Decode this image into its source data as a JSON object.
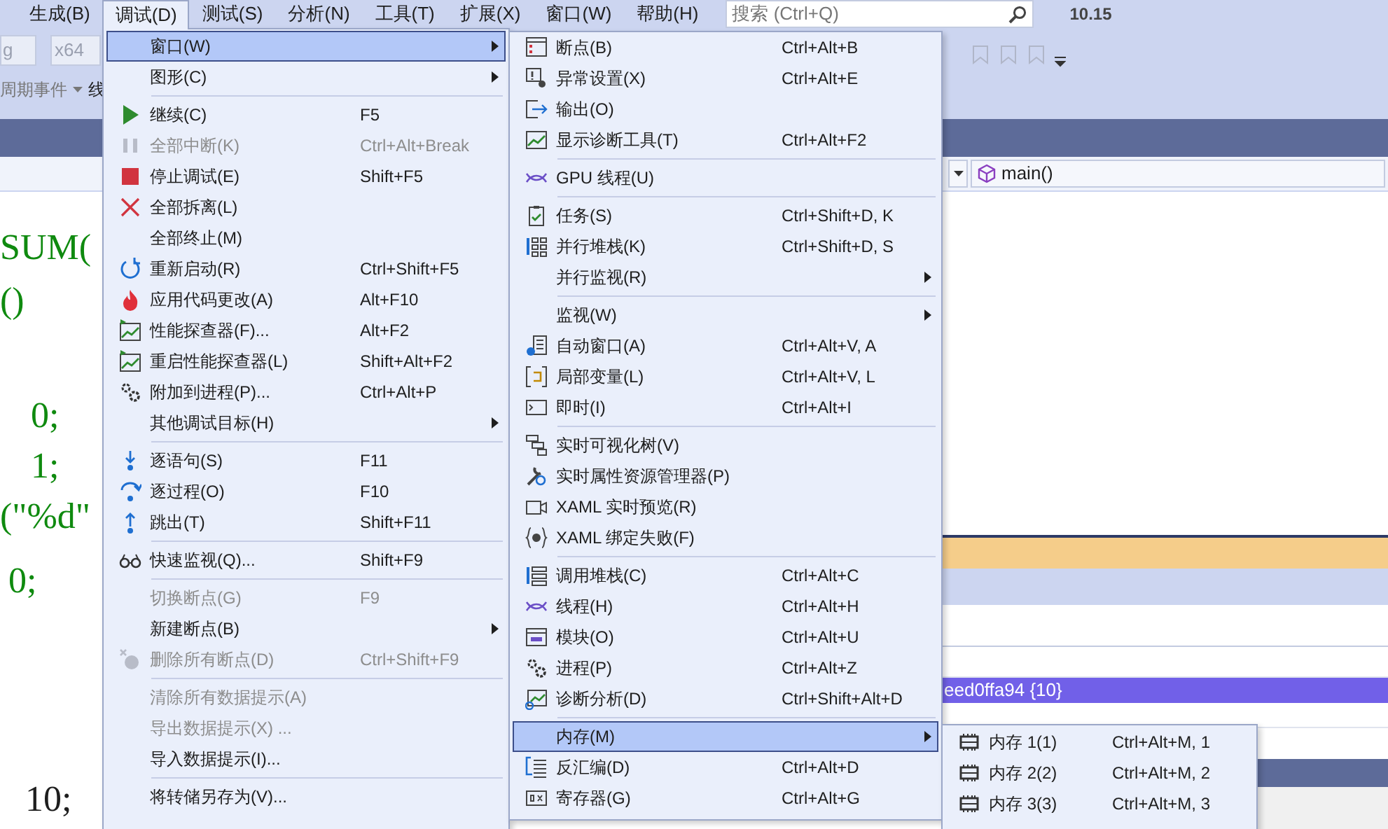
{
  "menubar": {
    "items": [
      {
        "label": "生成(B)",
        "selected": false
      },
      {
        "label": "调试(D)",
        "selected": true
      },
      {
        "label": "测试(S)",
        "selected": false
      },
      {
        "label": "分析(N)",
        "selected": false
      },
      {
        "label": "工具(T)",
        "selected": false
      },
      {
        "label": "扩展(X)",
        "selected": false
      },
      {
        "label": "窗口(W)",
        "selected": false
      },
      {
        "label": "帮助(H)",
        "selected": false
      }
    ],
    "search": {
      "placeholder": "搜索 (Ctrl+Q)"
    },
    "version": "10.15"
  },
  "toolbar": {
    "configuration": "g",
    "platform": "x64",
    "events_label": "周期事件",
    "thread_label": "线"
  },
  "navigation": {
    "function": "main()"
  },
  "editor": {
    "lines": [
      {
        "text": "SUM(",
        "kind": "code"
      },
      {
        "text": "()",
        "kind": "code"
      },
      {
        "text": "0;",
        "kind": "code"
      },
      {
        "text": "1;",
        "kind": "code"
      },
      {
        "text": "(\"%d\"",
        "kind": "code"
      },
      {
        "text": "0;",
        "kind": "code"
      },
      {
        "text": "10;",
        "kind": "literal"
      }
    ]
  },
  "watch_panel": {
    "selected_value": "eed0ffa94 {10}"
  },
  "debug_menu": {
    "items": [
      {
        "kind": "item",
        "label": "窗口(W)",
        "submenu": true,
        "selected": true,
        "disabled": false
      },
      {
        "kind": "item",
        "label": "图形(C)",
        "submenu": true,
        "selected": false,
        "disabled": false
      },
      {
        "kind": "separator"
      },
      {
        "kind": "item",
        "label": "继续(C)",
        "shortcut": "F5",
        "selected": false,
        "disabled": false
      },
      {
        "kind": "item",
        "label": "全部中断(K)",
        "shortcut": "Ctrl+Alt+Break",
        "selected": false,
        "disabled": true
      },
      {
        "kind": "item",
        "label": "停止调试(E)",
        "shortcut": "Shift+F5",
        "selected": false,
        "disabled": false
      },
      {
        "kind": "item",
        "label": "全部拆离(L)",
        "selected": false,
        "disabled": false
      },
      {
        "kind": "item",
        "label": "全部终止(M)",
        "selected": false,
        "disabled": false
      },
      {
        "kind": "item",
        "label": "重新启动(R)",
        "shortcut": "Ctrl+Shift+F5",
        "selected": false,
        "disabled": false
      },
      {
        "kind": "item",
        "label": "应用代码更改(A)",
        "shortcut": "Alt+F10",
        "selected": false,
        "disabled": false
      },
      {
        "kind": "item",
        "label": "性能探查器(F)...",
        "shortcut": "Alt+F2",
        "selected": false,
        "disabled": false
      },
      {
        "kind": "item",
        "label": "重启性能探查器(L)",
        "shortcut": "Shift+Alt+F2",
        "selected": false,
        "disabled": false
      },
      {
        "kind": "item",
        "label": "附加到进程(P)...",
        "shortcut": "Ctrl+Alt+P",
        "selected": false,
        "disabled": false
      },
      {
        "kind": "item",
        "label": "其他调试目标(H)",
        "submenu": true,
        "selected": false,
        "disabled": false
      },
      {
        "kind": "separator"
      },
      {
        "kind": "item",
        "label": "逐语句(S)",
        "shortcut": "F11",
        "selected": false,
        "disabled": false
      },
      {
        "kind": "item",
        "label": "逐过程(O)",
        "shortcut": "F10",
        "selected": false,
        "disabled": false
      },
      {
        "kind": "item",
        "label": "跳出(T)",
        "shortcut": "Shift+F11",
        "selected": false,
        "disabled": false
      },
      {
        "kind": "separator"
      },
      {
        "kind": "item",
        "label": "快速监视(Q)...",
        "shortcut": "Shift+F9",
        "selected": false,
        "disabled": false
      },
      {
        "kind": "separator"
      },
      {
        "kind": "item",
        "label": "切换断点(G)",
        "shortcut": "F9",
        "selected": false,
        "disabled": true
      },
      {
        "kind": "item",
        "label": "新建断点(B)",
        "submenu": true,
        "selected": false,
        "disabled": false
      },
      {
        "kind": "item",
        "label": "删除所有断点(D)",
        "shortcut": "Ctrl+Shift+F9",
        "selected": false,
        "disabled": true
      },
      {
        "kind": "separator"
      },
      {
        "kind": "item",
        "label": "清除所有数据提示(A)",
        "selected": false,
        "disabled": true
      },
      {
        "kind": "item",
        "label": "导出数据提示(X) ...",
        "selected": false,
        "disabled": true
      },
      {
        "kind": "item",
        "label": "导入数据提示(I)...",
        "selected": false,
        "disabled": false
      },
      {
        "kind": "separator"
      },
      {
        "kind": "item",
        "label": "将转储另存为(V)...",
        "selected": false,
        "disabled": false
      }
    ]
  },
  "window_submenu": {
    "items": [
      {
        "kind": "item",
        "label": "断点(B)",
        "shortcut": "Ctrl+Alt+B",
        "selected": false
      },
      {
        "kind": "item",
        "label": "异常设置(X)",
        "shortcut": "Ctrl+Alt+E",
        "selected": false
      },
      {
        "kind": "item",
        "label": "输出(O)",
        "selected": false
      },
      {
        "kind": "item",
        "label": "显示诊断工具(T)",
        "shortcut": "Ctrl+Alt+F2",
        "selected": false
      },
      {
        "kind": "separator"
      },
      {
        "kind": "item",
        "label": "GPU 线程(U)",
        "selected": false
      },
      {
        "kind": "separator"
      },
      {
        "kind": "item",
        "label": "任务(S)",
        "shortcut": "Ctrl+Shift+D, K",
        "selected": false
      },
      {
        "kind": "item",
        "label": "并行堆栈(K)",
        "shortcut": "Ctrl+Shift+D, S",
        "selected": false
      },
      {
        "kind": "item",
        "label": "并行监视(R)",
        "submenu": true,
        "selected": false
      },
      {
        "kind": "separator"
      },
      {
        "kind": "item",
        "label": "监视(W)",
        "submenu": true,
        "selected": false
      },
      {
        "kind": "item",
        "label": "自动窗口(A)",
        "shortcut": "Ctrl+Alt+V, A",
        "selected": false
      },
      {
        "kind": "item",
        "label": "局部变量(L)",
        "shortcut": "Ctrl+Alt+V, L",
        "selected": false
      },
      {
        "kind": "item",
        "label": "即时(I)",
        "shortcut": "Ctrl+Alt+I",
        "selected": false
      },
      {
        "kind": "separator"
      },
      {
        "kind": "item",
        "label": "实时可视化树(V)",
        "selected": false
      },
      {
        "kind": "item",
        "label": "实时属性资源管理器(P)",
        "selected": false
      },
      {
        "kind": "item",
        "label": "XAML 实时预览(R)",
        "selected": false
      },
      {
        "kind": "item",
        "label": "XAML 绑定失败(F)",
        "selected": false
      },
      {
        "kind": "separator"
      },
      {
        "kind": "item",
        "label": "调用堆栈(C)",
        "shortcut": "Ctrl+Alt+C",
        "selected": false
      },
      {
        "kind": "item",
        "label": "线程(H)",
        "shortcut": "Ctrl+Alt+H",
        "selected": false
      },
      {
        "kind": "item",
        "label": "模块(O)",
        "shortcut": "Ctrl+Alt+U",
        "selected": false
      },
      {
        "kind": "item",
        "label": "进程(P)",
        "shortcut": "Ctrl+Alt+Z",
        "selected": false
      },
      {
        "kind": "item",
        "label": "诊断分析(D)",
        "shortcut": "Ctrl+Shift+Alt+D",
        "selected": false
      },
      {
        "kind": "separator"
      },
      {
        "kind": "item",
        "label": "内存(M)",
        "submenu": true,
        "selected": true
      },
      {
        "kind": "item",
        "label": "反汇编(D)",
        "shortcut": "Ctrl+Alt+D",
        "selected": false
      },
      {
        "kind": "item",
        "label": "寄存器(G)",
        "shortcut": "Ctrl+Alt+G",
        "selected": false
      }
    ]
  },
  "memory_submenu": {
    "items": [
      {
        "kind": "item",
        "label": "内存 1(1)",
        "shortcut": "Ctrl+Alt+M, 1",
        "selected": false
      },
      {
        "kind": "item",
        "label": "内存 2(2)",
        "shortcut": "Ctrl+Alt+M, 2",
        "selected": false
      },
      {
        "kind": "item",
        "label": "内存 3(3)",
        "shortcut": "Ctrl+Alt+M, 3",
        "selected": false
      }
    ]
  }
}
